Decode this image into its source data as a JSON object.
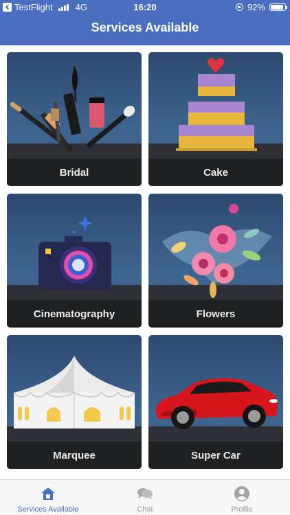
{
  "status_bar": {
    "app": "TestFlight",
    "network": "4G",
    "time": "16:20",
    "battery": "92%",
    "battery_level": 0.92
  },
  "header": {
    "title": "Services Available"
  },
  "services": [
    {
      "label": "Bridal",
      "icon": "makeup-brushes-icon"
    },
    {
      "label": "Cake",
      "icon": "wedding-cake-icon"
    },
    {
      "label": "Cinematography",
      "icon": "camera-icon"
    },
    {
      "label": "Flowers",
      "icon": "flower-bouquet-icon"
    },
    {
      "label": "Marquee",
      "icon": "marquee-tent-icon"
    },
    {
      "label": "Super Car",
      "icon": "sports-car-icon"
    }
  ],
  "tabs": [
    {
      "label": "Services Available",
      "icon": "home-icon",
      "active": true
    },
    {
      "label": "Chat",
      "icon": "chat-bubbles-icon",
      "active": false
    },
    {
      "label": "Profile",
      "icon": "user-icon",
      "active": false
    }
  ],
  "colors": {
    "header": "#4a6fc1",
    "active_tab": "#4a6fc1",
    "inactive_tab": "#9b9b9b",
    "card_label_bg": "#1f2022"
  }
}
